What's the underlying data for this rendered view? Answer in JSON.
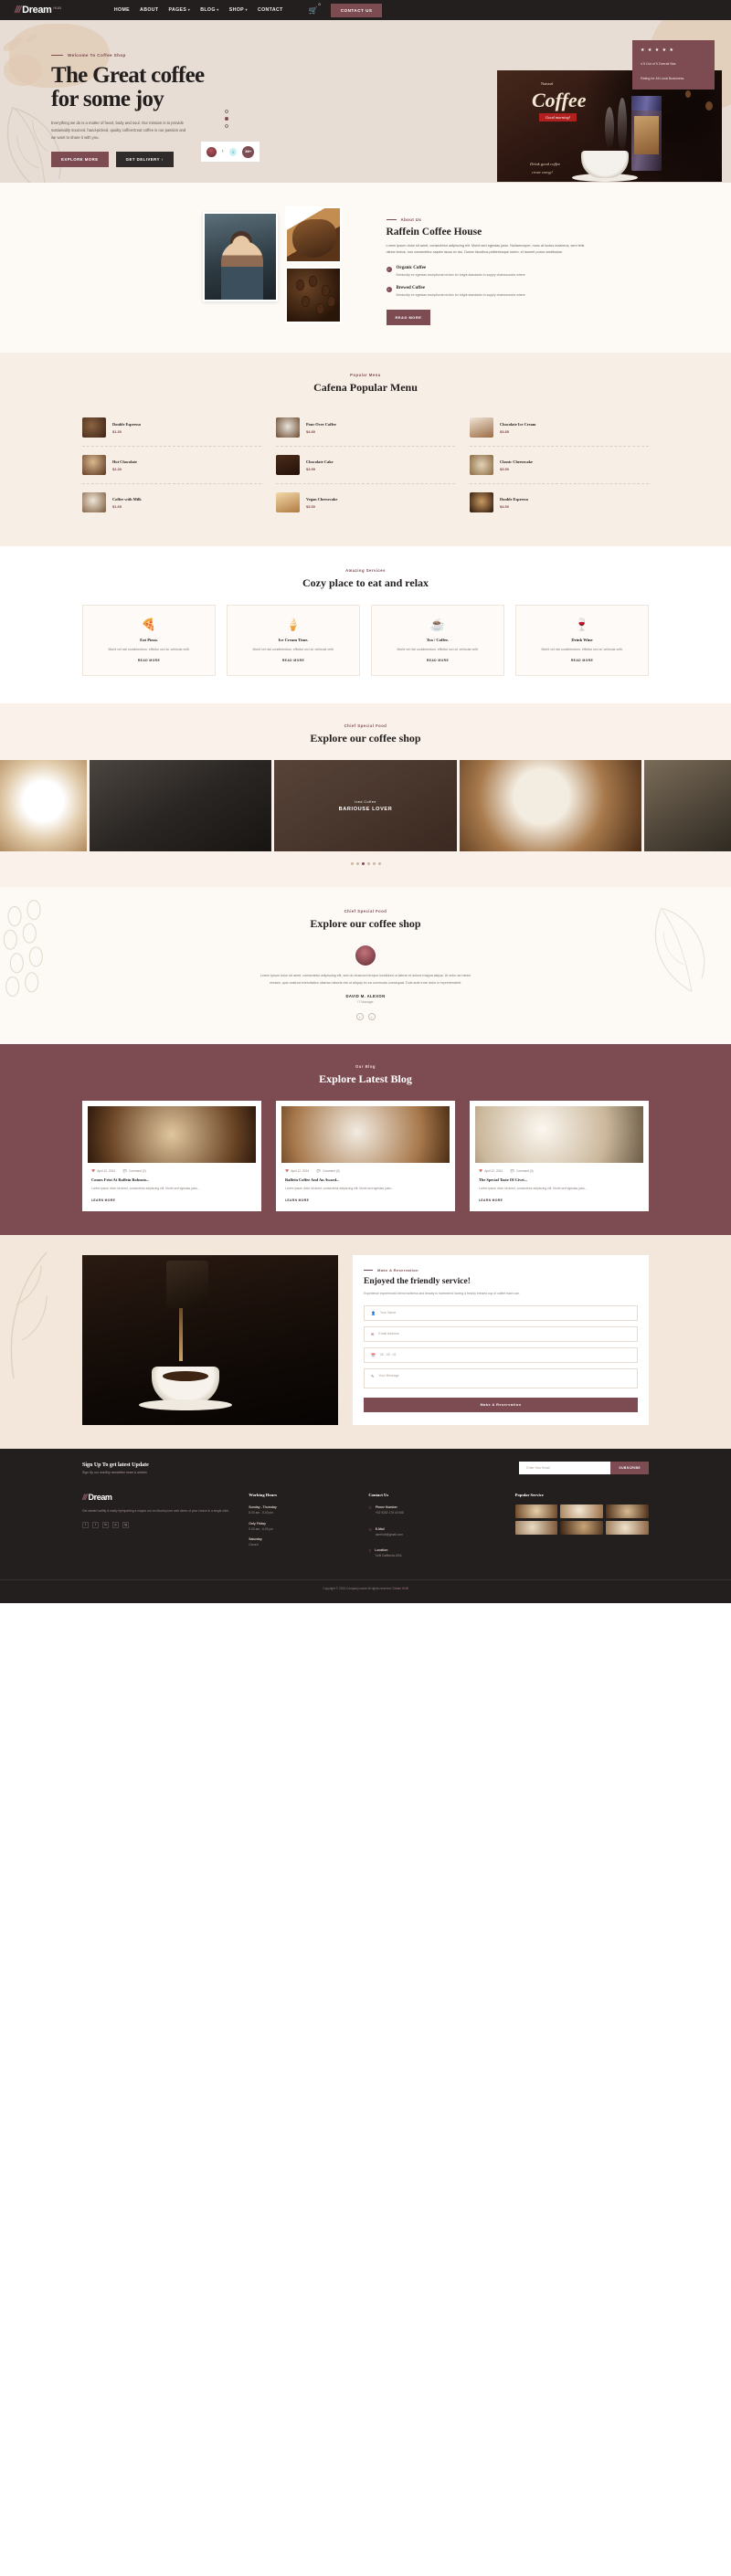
{
  "header": {
    "logo_slash": "///",
    "logo_text": "Dream",
    "logo_sup": "HUB",
    "nav": [
      {
        "label": "HOME",
        "caret": false
      },
      {
        "label": "ABOUT",
        "caret": false
      },
      {
        "label": "PAGES",
        "caret": true
      },
      {
        "label": "BLOG",
        "caret": true
      },
      {
        "label": "SHOP",
        "caret": true
      },
      {
        "label": "CONTACT",
        "caret": false
      }
    ],
    "cart_icon": "cart-icon",
    "cart_count": "0",
    "contact_button": "CONTACT US"
  },
  "hero": {
    "eyebrow": "Welcome To Coffee Shop",
    "title_line1": "The Great coffee",
    "title_line2": "for some joy",
    "description": "Everything we do is a matter of heart, body and soul. Our mission is to provide sustainably sourced, hand-picked, quality coffeeGreat coffee is our passion and we want to share it with you.",
    "btn_primary": "EXPLORE MORE",
    "btn_secondary": "GET DELIVERY",
    "rating_stars": "★ ★ ★ ★ ★",
    "rating_line1": "4.5 Out of 5 Overall Star",
    "rating_line2": "Rating for All Local Bussiness.",
    "promo_label": "Natural",
    "promo_title": "Coffee",
    "promo_badge": "Good morning!",
    "promo_sub": "Drink good coffee",
    "promo_sub2": "create energy!",
    "press_s": "S",
    "press_m": "3M+"
  },
  "about": {
    "eyebrow": "About Us",
    "title": "Raffein Coffee House",
    "description": "Lorem ipsum dolor sit amet, consectetur adipiscing elit. Morbi sed egestas justo. Nullamcorper, nunc at luctus maximus, sem felis ultrice lectus, non consectetur sapien lacus ex dui. Donec faucibus pellentesque lorem, et laoreet purus vestibulum.",
    "features": [
      {
        "title": "Organic Coffee",
        "text": "Nimlorcity ex egestas exceptional nicheo for bright standards in supply chainsources where"
      },
      {
        "title": "Brewed Coffee",
        "text": "Nimlorcity ex egestas exceptional nicheo for bright standards in supply chainsources where"
      }
    ],
    "btn": "READ MORE"
  },
  "menu": {
    "eyebrow": "Popular Menu",
    "title": "Cafena Popular Menu",
    "items": [
      {
        "name": "Double Espresso",
        "price": "$1.30"
      },
      {
        "name": "Pour Over Coffee",
        "price": "$4.80"
      },
      {
        "name": "Chocolate Ice Cream",
        "price": "$3.85"
      },
      {
        "name": "Hot Chocolate",
        "price": "$2.30"
      },
      {
        "name": "Chocolate Cake",
        "price": "$3.99"
      },
      {
        "name": "Classic Cheesecake",
        "price": "$3.50"
      },
      {
        "name": "Coffee with Milk",
        "price": "$1.65"
      },
      {
        "name": "Vegan Cheesecake",
        "price": "$3.50"
      },
      {
        "name": "Double Espresso",
        "price": "$4.50"
      }
    ]
  },
  "services": {
    "eyebrow": "Amazing Services",
    "title": "Cozy place to eat and relax",
    "cards": [
      {
        "icon": "pizza-icon",
        "glyph": "🍕",
        "title": "Eat Pizza.",
        "text": "Morbi vel nisi condimentum, efficitur orci at, vehicula velit.",
        "more": "READ MORE"
      },
      {
        "icon": "ice-cream-icon",
        "glyph": "🍦",
        "title": "Ice Cream Time.",
        "text": "Morbi vel nisi condimentum, efficitur orci at, vehicula velit.",
        "more": "READ MORE"
      },
      {
        "icon": "tea-cup-icon",
        "glyph": "☕",
        "title": "Tea / Coffee.",
        "text": "Morbi vel nisi condimentum, efficitur orci at, vehicula velit.",
        "more": "READ MORE"
      },
      {
        "icon": "wine-icon",
        "glyph": "🍷",
        "title": "Drink Wine",
        "text": "Morbi vel nisi condimentum, efficitur orci at, vehicula velit.",
        "more": "READ MORE"
      }
    ]
  },
  "gallery": {
    "eyebrow": "Chief Special Food",
    "title": "Explore our coffee shop",
    "overlay_sub": "Iced Coffee",
    "overlay_title": "BARIOUSE LOVER",
    "dot_count": 6,
    "active_dot": 2
  },
  "testimonial": {
    "eyebrow": "Chief Special Food",
    "title": "Explore our coffee shop",
    "quote": "Lorem ipsum dolor sit amet, consectetur adipiscing elit, sed do eiusmod tempor incididunt ut labore et dolore magna aliqua. Ut enim ad minim veniam, quis nostrud exercitation ullamco laboris nisi ut aliquip ex ea commodo consequat. Duis aute irure dolor in reprehenderit.",
    "name": "DAVID M. ALEXON",
    "role": "IT Manager"
  },
  "blog": {
    "eyebrow": "Our Blog",
    "title": "Explore Latest Blog",
    "posts": [
      {
        "date": "April 10, 2024",
        "comments": "Comment (2)",
        "title": "Comes Frist At Raffein Robusto...",
        "text": "Lorem ipsum dolor sit amet, consectetur adipiscing elit. Morbi sed egestas justo...",
        "learn": "LEARN MORE"
      },
      {
        "date": "April 12, 2024",
        "comments": "Comment (0)",
        "title": "Raffein Coffee And An Award...",
        "text": "Lorem ipsum dolor sit amet, consectetur adipiscing elit. Morbi sed egestas justo...",
        "learn": "LEARN MORE"
      },
      {
        "date": "April 12, 2024",
        "comments": "Comment (0)",
        "title": "The Special Taste Of Civet...",
        "text": "Lorem ipsum dolor sit amet, consectetur adipiscing elit. Morbi sed egestas justo...",
        "learn": "LEARN MORE"
      }
    ]
  },
  "reservation": {
    "eyebrow": "Make A Reservation",
    "title": "Enjoyed the friendly service!",
    "description": "Experience experienced blend wellness and beauty to hammered having a freshly brewed cup of coffee each use.",
    "fields": [
      {
        "icon": "user-icon",
        "glyph": "👤",
        "placeholder": "Your Name"
      },
      {
        "icon": "mail-icon",
        "glyph": "✉",
        "placeholder": "Email Address"
      },
      {
        "icon": "calendar-icon",
        "glyph": "📅",
        "placeholder": "06 : 05 : 02"
      },
      {
        "icon": "message-icon",
        "glyph": "✎",
        "placeholder": "Your Message"
      }
    ],
    "button": "Make A Reservation"
  },
  "newsletter": {
    "title": "Sign Up To get latest Update",
    "subtitle": "Sign Up our monthly newsletter news & articles",
    "placeholder": "Enter Your Email",
    "button": "SUBSCRIBE"
  },
  "footer": {
    "logo_slash": "///",
    "logo_text": "Dream",
    "about": "Get started swiftly & easily byimparting a majors our on Mount purer web demo of your choice in a single click.",
    "socials": [
      "f",
      "t",
      "in",
      "p",
      "ig"
    ],
    "working_hours_title": "Working Hours",
    "working_hours": [
      {
        "day": "Sunday - Thursday",
        "time": "8.00 am - 5.00 pm"
      },
      {
        "day": "Only Friday",
        "time": "9.00 am - 6.00 pm"
      },
      {
        "day": "Saturday",
        "time": "Closed"
      }
    ],
    "contact_title": "Contact Us",
    "contacts": [
      {
        "icon": "phone-icon",
        "glyph": "✆",
        "label": "Phone Number",
        "value": "+62 9282 178 44 648"
      },
      {
        "icon": "mail-icon",
        "glyph": "✉",
        "label": "E-Mail",
        "value": "userhub@gmail.com"
      },
      {
        "icon": "pin-icon",
        "glyph": "⚲",
        "label": "Location",
        "value": "7a/B California,USA"
      }
    ],
    "products_title": "Popular Service",
    "copyright_prefix": "Copyright © 2024 Company name All rights reserved.",
    "copyright_link": "Dream HUB"
  }
}
